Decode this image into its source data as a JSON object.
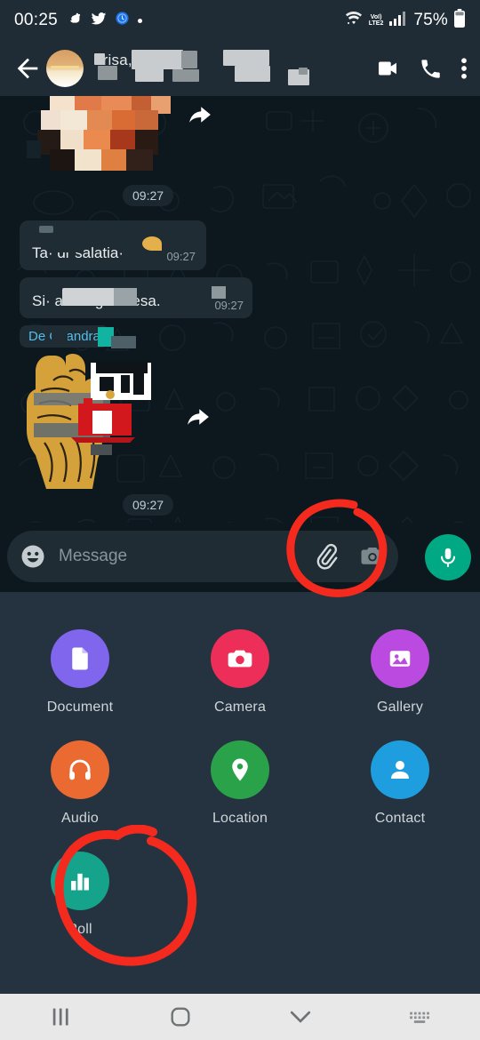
{
  "status_bar": {
    "time": "00:25",
    "icons": [
      "duck-app-icon",
      "twitter-icon",
      "blue-badge-icon",
      "dot-icon"
    ],
    "network_label_top": "VoI)",
    "network_label_bottom": "LTE2",
    "battery_percent": "75%",
    "icons_right": [
      "wifi-icon",
      "volte-icon",
      "signal-bars-icon",
      "battery-icon"
    ]
  },
  "chat_header": {
    "title": "hrisa, / ..l, .",
    "back_icon": "back-arrow-icon",
    "avatar": "group-avatar",
    "actions": [
      "video-call-icon",
      "voice-call-icon",
      "overflow-menu-icon"
    ]
  },
  "chat": {
    "messages": [
      {
        "type": "media",
        "name": "censored-photo",
        "time": "09:27",
        "forwarded": true
      },
      {
        "type": "text",
        "text": "Ta·      dr salatia·",
        "time": "09:27"
      },
      {
        "type": "text",
        "text": "Si·              an sing melesa.",
        "time": "09:27"
      },
      {
        "type": "sender",
        "text": "De    Chandra"
      },
      {
        "type": "media",
        "name": "fist-sticker",
        "time": "09:27",
        "forwarded": true
      }
    ]
  },
  "input_bar": {
    "emoji_icon": "emoji-icon",
    "placeholder": "Message",
    "value": "",
    "attach_icon": "paperclip-icon",
    "camera_icon": "camera-icon",
    "mic_icon": "microphone-icon",
    "mic_color": "#00a884"
  },
  "attachment_menu": {
    "items": [
      {
        "label": "Document",
        "icon": "document-icon",
        "color": "#7f66ec"
      },
      {
        "label": "Camera",
        "icon": "camera-icon",
        "color": "#ec2e58"
      },
      {
        "label": "Gallery",
        "icon": "gallery-icon",
        "color": "#bb4ae0"
      },
      {
        "label": "Audio",
        "icon": "headphones-icon",
        "color": "#ea6a31"
      },
      {
        "label": "Location",
        "icon": "location-pin-icon",
        "color": "#2aa24a"
      },
      {
        "label": "Contact",
        "icon": "person-icon",
        "color": "#1e9ede"
      },
      {
        "label": "Poll",
        "icon": "bar-chart-icon",
        "color": "#15a38b"
      }
    ]
  },
  "annotations": {
    "color": "#f42a1e",
    "shapes": [
      "circle-around-paperclip",
      "circle-around-poll"
    ]
  },
  "nav_bar": {
    "buttons": [
      "recents-icon",
      "home-icon",
      "hide-keyboard-icon",
      "keyboard-icon"
    ]
  },
  "colors": {
    "header_bg": "#1f2c35",
    "chat_bg": "#0d181e",
    "bubble_bg": "#1f2c33",
    "panel_bg": "#253340",
    "sender_name": "#53bdeb",
    "navbar_bg": "#e8e8e8"
  }
}
